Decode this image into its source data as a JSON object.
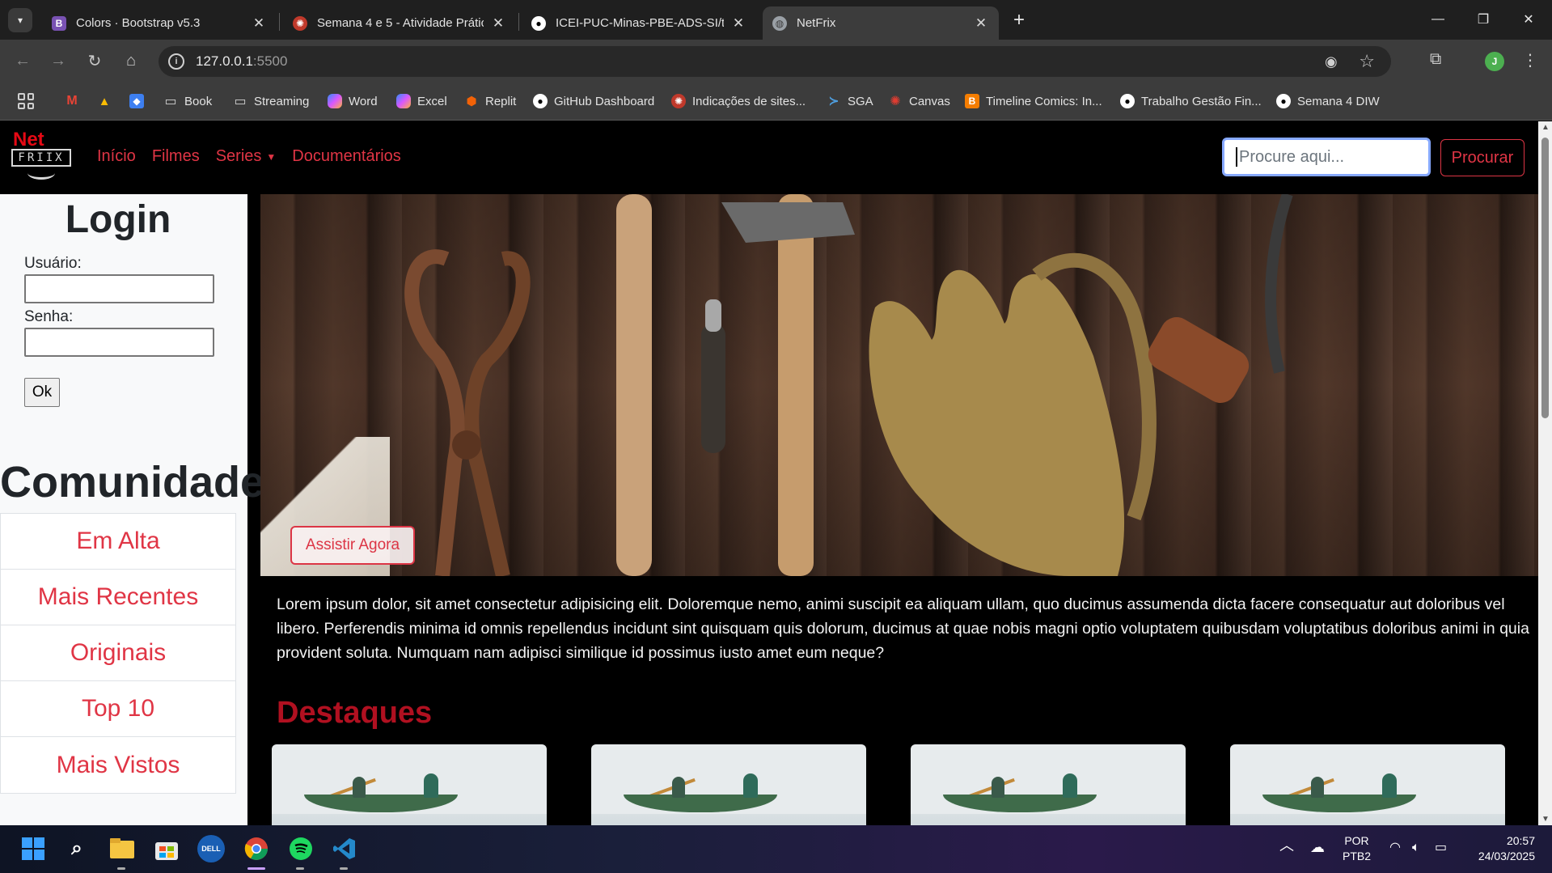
{
  "browser": {
    "tabs": [
      {
        "title": "Colors · Bootstrap v5.3",
        "icon": "bootstrap-icon",
        "color": "#7952b3"
      },
      {
        "title": "Semana 4 e 5 - Atividade Prátic",
        "icon": "puc-icon",
        "color": "#c0392b"
      },
      {
        "title": "ICEI-PUC-Minas-PBE-ADS-SI/tr",
        "icon": "github-icon",
        "color": "#ffffff"
      },
      {
        "title": "NetFrix",
        "icon": "globe-icon",
        "color": "#9aa0a6"
      }
    ],
    "url_host": "127.0.0.1",
    "url_port": ":5500",
    "profile_initial": "J",
    "bookmarks": [
      {
        "label": "",
        "icon": "gmail-icon"
      },
      {
        "label": "",
        "icon": "drive-icon"
      },
      {
        "label": "",
        "icon": "dropbox-icon"
      },
      {
        "label": "Book",
        "icon": "folder-icon"
      },
      {
        "label": "Streaming",
        "icon": "folder-icon"
      },
      {
        "label": "Word",
        "icon": "copilot-icon"
      },
      {
        "label": "Excel",
        "icon": "copilot-icon"
      },
      {
        "label": "Replit",
        "icon": "replit-icon"
      },
      {
        "label": "GitHub Dashboard",
        "icon": "github-icon"
      },
      {
        "label": "Indicações de sites...",
        "icon": "puc-icon"
      },
      {
        "label": "SGA",
        "icon": "sga-icon"
      },
      {
        "label": "Canvas",
        "icon": "canvas-icon"
      },
      {
        "label": "Timeline Comics: In...",
        "icon": "blogger-icon"
      },
      {
        "label": "Trabalho Gestão Fin...",
        "icon": "github-icon"
      },
      {
        "label": "Semana 4 DIW",
        "icon": "github-icon"
      }
    ]
  },
  "site": {
    "logo_top": "Net",
    "logo_box": "FRIIX",
    "nav": [
      "Início",
      "Filmes",
      "Series",
      "Documentários"
    ],
    "search_placeholder": "Procure aqui...",
    "search_button": "Procurar",
    "accent_color": "#dc3545"
  },
  "sidebar": {
    "login_title": "Login",
    "user_label": "Usuário:",
    "password_label": "Senha:",
    "ok_label": "Ok",
    "community_title": "Comunidade",
    "community_items": [
      "Em Alta",
      "Mais Recentes",
      "Originais",
      "Top 10",
      "Mais Vistos"
    ]
  },
  "main": {
    "watch_button": "Assistir Agora",
    "intro": "Lorem ipsum dolor, sit amet consectetur adipisicing elit. Doloremque nemo, animi suscipit ea aliquam ullam, quo ducimus assumenda dicta facere consequatur aut doloribus vel libero. Perferendis minima id omnis repellendus incidunt sint quisquam quis dolorum, ducimus at quae nobis magni optio voluptatem quibusdam voluptatibus doloribus animi in quia provident soluta. Numquam nam adipisci similique id possimus iusto amet eum neque?",
    "highlights_title": "Destaques",
    "card_count": 4
  },
  "taskbar": {
    "language": "POR",
    "layout": "PTB2",
    "time": "20:57",
    "date": "24/03/2025"
  }
}
